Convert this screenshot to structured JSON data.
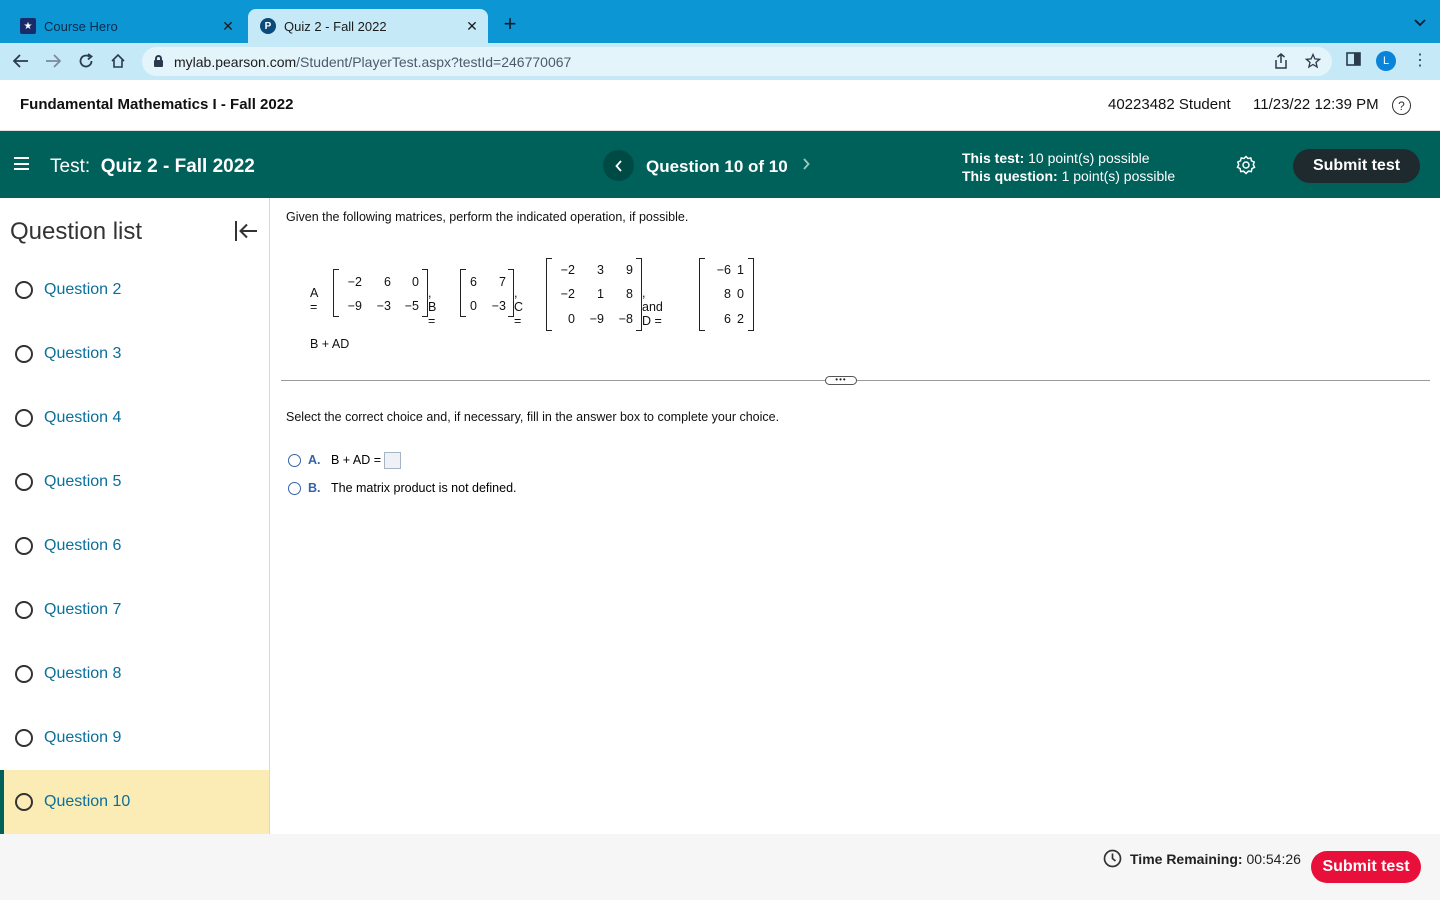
{
  "browser": {
    "tabs": [
      {
        "title": "Course Hero",
        "close": "✕"
      },
      {
        "title": "Quiz 2 - Fall 2022",
        "close": "✕"
      }
    ],
    "new_tab": "+",
    "url_host": "mylab.pearson.com",
    "url_path": "/Student/PlayerTest.aspx?testId=246770067",
    "profile_initial": "L"
  },
  "header": {
    "course_title": "Fundamental Mathematics I - Fall 2022",
    "student": "40223482 Student",
    "datetime": "11/23/22 12:39 PM",
    "help": "?"
  },
  "toolbar": {
    "test_prefix": "Test:",
    "test_name": "Quiz 2 - Fall 2022",
    "question_counter": "Question 10 of 10",
    "test_points_label": "This test:",
    "test_points_value": "10 point(s) possible",
    "question_points_label": "This question:",
    "question_points_value": "1 point(s) possible",
    "submit_label": "Submit test"
  },
  "sidebar": {
    "title": "Question list",
    "items": [
      {
        "label": "Question 2"
      },
      {
        "label": "Question 3"
      },
      {
        "label": "Question 4"
      },
      {
        "label": "Question 5"
      },
      {
        "label": "Question 6"
      },
      {
        "label": "Question 7"
      },
      {
        "label": "Question 8"
      },
      {
        "label": "Question 9"
      },
      {
        "label": "Question 10",
        "active": true
      }
    ]
  },
  "question": {
    "instructions": "Given the following matrices, perform the indicated operation, if possible.",
    "matrices": {
      "A": {
        "label": "A =",
        "rows": [
          [
            "−2",
            "6",
            "0"
          ],
          [
            "−9",
            "−3",
            "−5"
          ]
        ]
      },
      "B": {
        "label": ", B =",
        "rows": [
          [
            "6",
            "7"
          ],
          [
            "0",
            "−3"
          ]
        ]
      },
      "C": {
        "label": ", C =",
        "rows": [
          [
            "−2",
            "3",
            "9"
          ],
          [
            "−2",
            "1",
            "8"
          ],
          [
            "0",
            "−9",
            "−8"
          ]
        ]
      },
      "D": {
        "label": ", and D =",
        "rows": [
          [
            "−6",
            "1"
          ],
          [
            "8",
            "0"
          ],
          [
            "6",
            "2"
          ]
        ]
      }
    },
    "expression": "B + AD",
    "more_indicator": "•••",
    "select_prompt": "Select the correct choice and, if necessary, fill in the answer box to complete your choice.",
    "choices": [
      {
        "letter": "A.",
        "text": "B + AD ="
      },
      {
        "letter": "B.",
        "text": "The matrix product is not defined."
      }
    ]
  },
  "footer": {
    "time_label": "Time Remaining:",
    "time_value": "00:54:26",
    "submit_label": "Submit test"
  }
}
